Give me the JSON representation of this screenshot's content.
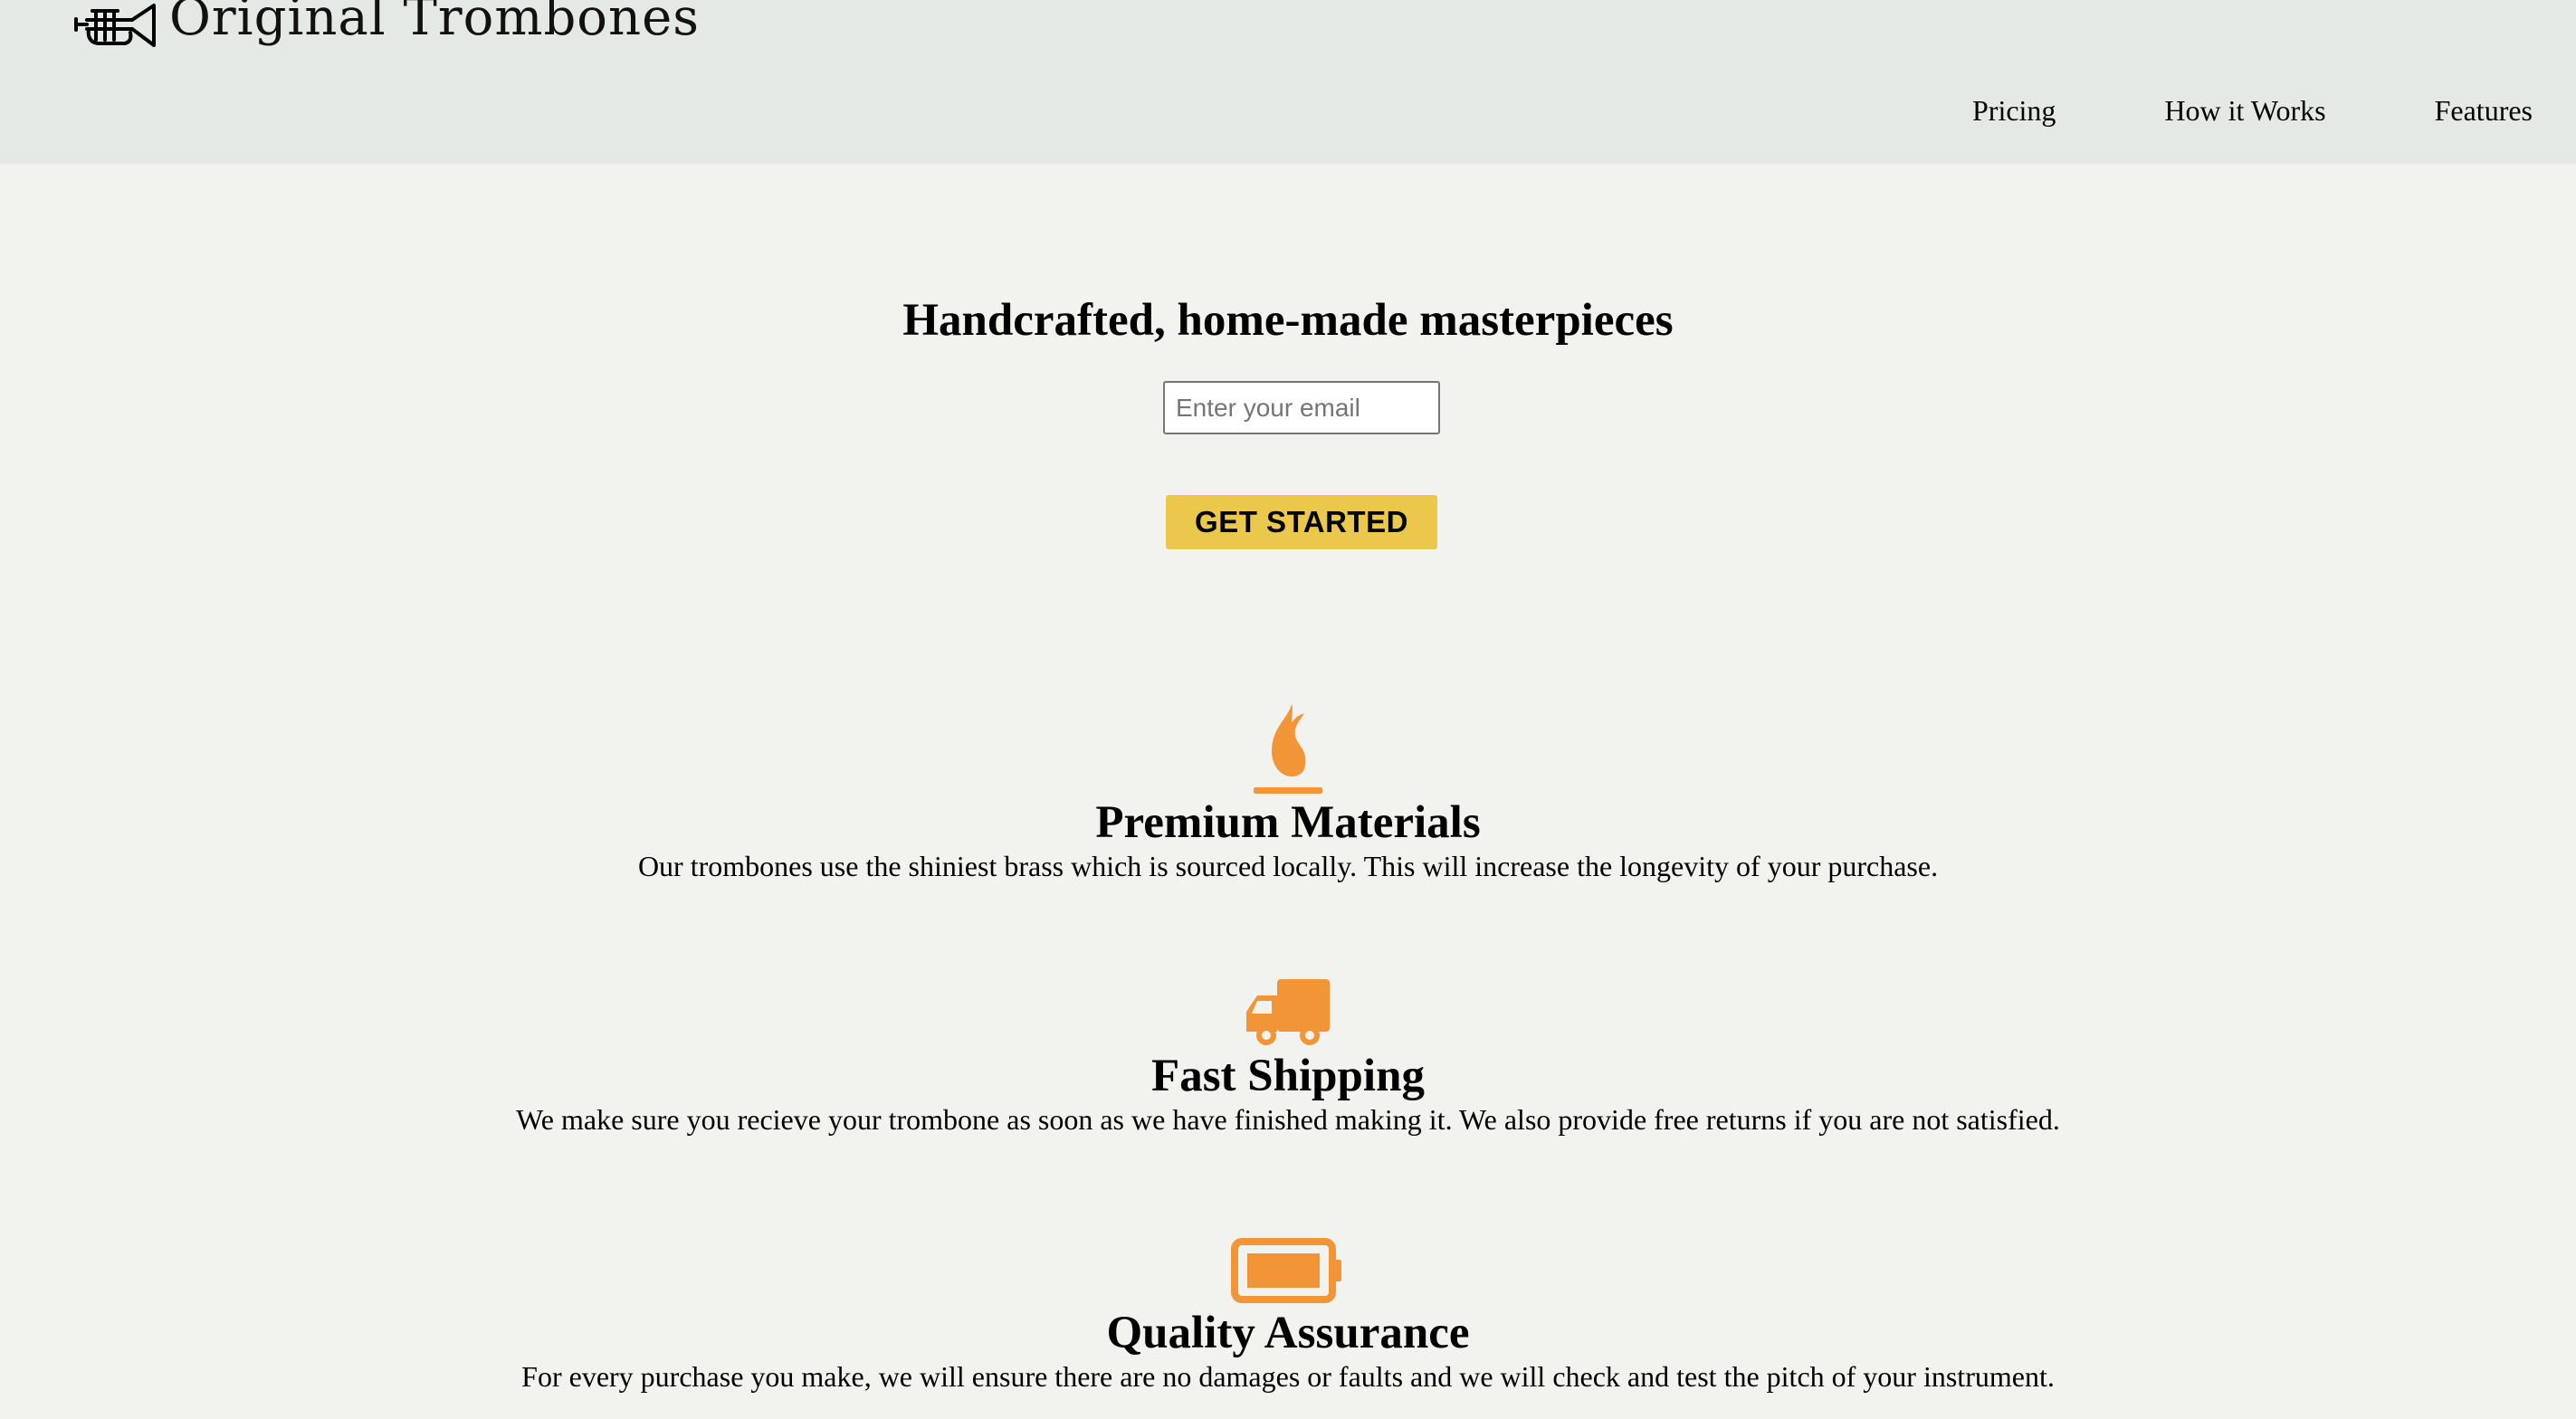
{
  "header": {
    "brand": "Original Trombones",
    "logo_icon": "trumpet-logo-icon",
    "nav": [
      {
        "label": "Pricing"
      },
      {
        "label": "How it Works"
      },
      {
        "label": "Features"
      }
    ]
  },
  "hero": {
    "title": "Handcrafted, home-made masterpieces",
    "email_placeholder": "Enter your email",
    "email_value": "",
    "cta_label": "GET STARTED"
  },
  "features": [
    {
      "icon": "fire-icon",
      "title": "Premium Materials",
      "description": "Our trombones use the shiniest brass which is sourced locally. This will increase the longevity of your purchase."
    },
    {
      "icon": "truck-icon",
      "title": "Fast Shipping",
      "description": "We make sure you recieve your trombone as soon as we have finished making it. We also provide free returns if you are not satisfied."
    },
    {
      "icon": "battery-full-icon",
      "title": "Quality Assurance",
      "description": "For every purchase you make, we will ensure there are no damages or faults and we will check and test the pitch of your instrument."
    }
  ],
  "colors": {
    "header_bg": "#e5e9e6",
    "page_bg": "#f2f2ee",
    "accent_orange": "#f29536",
    "cta_yellow": "#ebc84b"
  }
}
